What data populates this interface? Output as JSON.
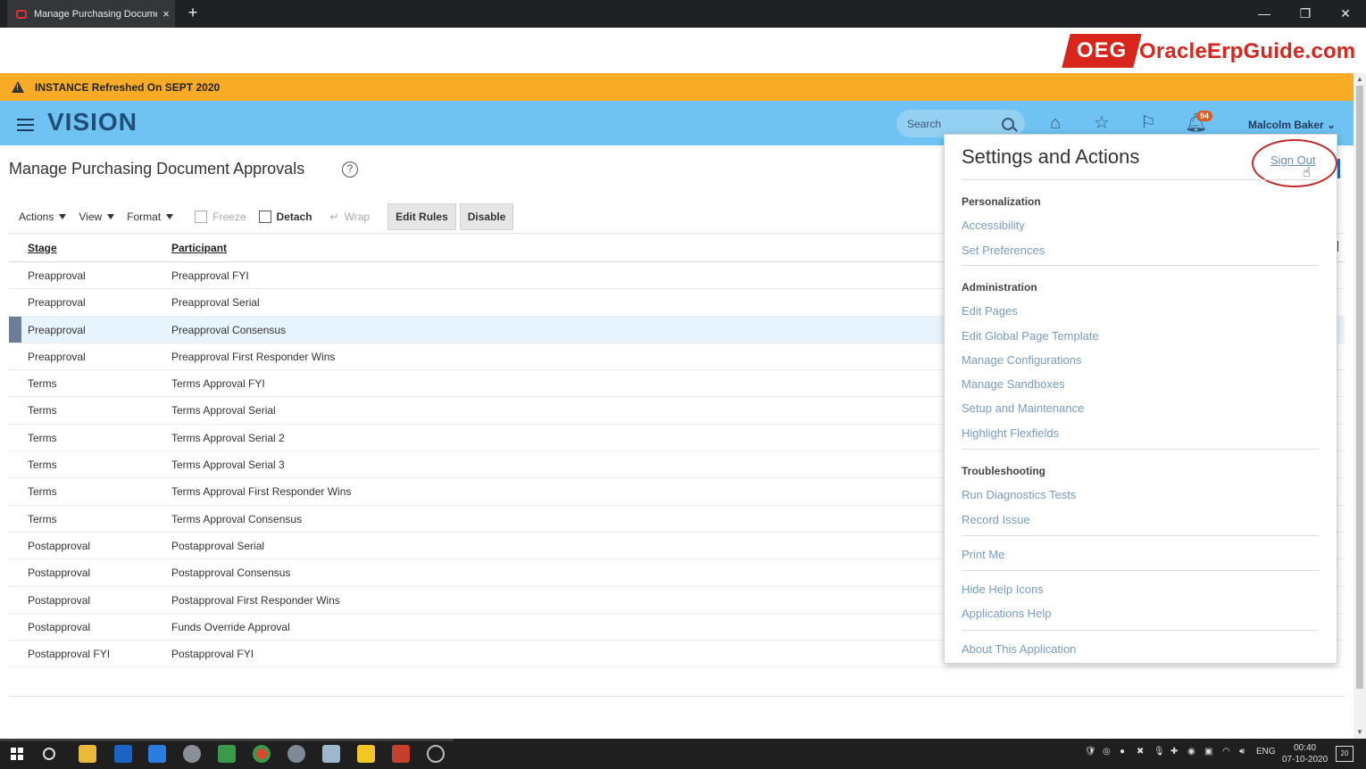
{
  "browser": {
    "tab_title": "Manage Purchasing Document A",
    "close_glyph": "×",
    "new_tab_glyph": "+",
    "window_controls": [
      "—",
      "❐",
      "✕"
    ]
  },
  "brand": {
    "logo_box": "OEG",
    "logo_text": "OracleErpGuide.com"
  },
  "banner": {
    "text": "INSTANCE Refreshed On SEPT 2020"
  },
  "header": {
    "app_name": "VISION",
    "search_placeholder": "Search",
    "notification_count": "94",
    "user_name": "Malcolm Baker ⌄"
  },
  "page": {
    "title": "Manage Purchasing Document Approvals",
    "help_glyph": "?"
  },
  "toolbar": {
    "actions": "Actions",
    "view": "View",
    "format": "Format",
    "freeze": "Freeze",
    "detach": "Detach",
    "wrap": "Wrap",
    "edit_rules": "Edit Rules",
    "disable": "Disable"
  },
  "table": {
    "columns": [
      "Stage",
      "Participant"
    ],
    "rows": [
      {
        "stage": "Preapproval",
        "participant": "Preapproval FYI"
      },
      {
        "stage": "Preapproval",
        "participant": "Preapproval Serial"
      },
      {
        "stage": "Preapproval",
        "participant": "Preapproval Consensus"
      },
      {
        "stage": "Preapproval",
        "participant": "Preapproval First Responder Wins"
      },
      {
        "stage": "Terms",
        "participant": "Terms Approval FYI"
      },
      {
        "stage": "Terms",
        "participant": "Terms Approval Serial"
      },
      {
        "stage": "Terms",
        "participant": "Terms Approval Serial 2"
      },
      {
        "stage": "Terms",
        "participant": "Terms Approval Serial 3"
      },
      {
        "stage": "Terms",
        "participant": "Terms Approval First Responder Wins"
      },
      {
        "stage": "Terms",
        "participant": "Terms Approval Consensus"
      },
      {
        "stage": "Postapproval",
        "participant": "Postapproval Serial"
      },
      {
        "stage": "Postapproval",
        "participant": "Postapproval Consensus"
      },
      {
        "stage": "Postapproval",
        "participant": "Postapproval First Responder Wins"
      },
      {
        "stage": "Postapproval",
        "participant": "Funds Override Approval"
      },
      {
        "stage": "Postapproval FYI",
        "participant": "Postapproval FYI"
      }
    ]
  },
  "settings_popup": {
    "title": "Settings and Actions",
    "sign_out": "Sign Out",
    "sections": {
      "personalization": "Personalization",
      "administration": "Administration",
      "troubleshooting": "Troubleshooting"
    },
    "links": {
      "accessibility": "Accessibility",
      "set_preferences": "Set Preferences",
      "edit_pages": "Edit Pages",
      "edit_global_page_template": "Edit Global Page Template",
      "manage_configurations": "Manage Configurations",
      "manage_sandboxes": "Manage Sandboxes",
      "setup_and_maintenance": "Setup and Maintenance",
      "highlight_flexfields": "Highlight Flexfields",
      "run_diagnostics_tests": "Run Diagnostics Tests",
      "record_issue": "Record Issue",
      "print_me": "Print Me",
      "hide_help_icons": "Hide Help Icons",
      "applications_help": "Applications Help",
      "about_this_application": "About This Application"
    }
  },
  "taskbar": {
    "language": "ENG",
    "time": "00:40",
    "date": "07-10-2020",
    "notification_count": "20"
  },
  "colors": {
    "banner": "#f8ab25",
    "header": "#6ec3f2",
    "brand_red": "#d9261c",
    "link": "#7a9cbf",
    "selected_row": "#e8f4fd"
  }
}
